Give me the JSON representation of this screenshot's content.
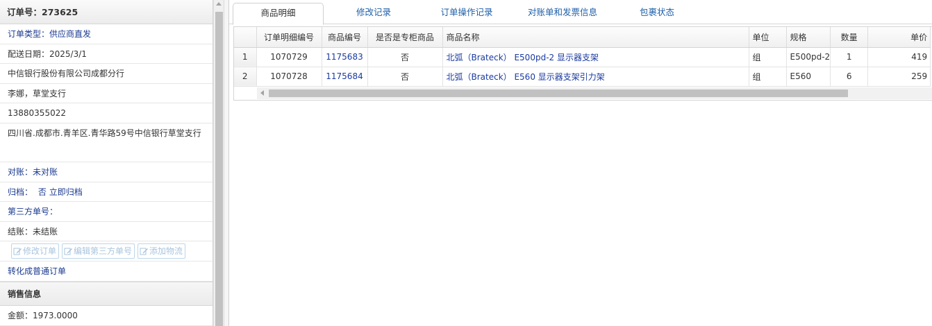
{
  "order": {
    "header": "订单号：273625",
    "type_label": "订单类型：",
    "type_value": "供应商直发",
    "delivery_date": "配送日期：2025/3/1",
    "company": "中信银行股份有限公司成都分行",
    "contact": "李娜，草堂支行",
    "phone": "13880355022",
    "address": "四川省.成都市.青羊区.青华路59号中信银行草堂支行",
    "reconcile": "对账：未对账",
    "archive_label": "归档：",
    "archive_value": "否",
    "archive_link": "立即归档",
    "third_party": "第三方单号：",
    "settlement": "结账：未结账",
    "buttons": {
      "edit_order": "修改订单",
      "edit_third_party": "编辑第三方单号",
      "add_logistics": "添加物流"
    },
    "convert_link": "转化成普通订单",
    "sales_section": "销售信息",
    "amount": "金额：1973.0000"
  },
  "tabs": [
    {
      "label": "商品明细",
      "active": true
    },
    {
      "label": "修改记录",
      "active": false
    },
    {
      "label": "订单操作记录",
      "active": false
    },
    {
      "label": "对账单和发票信息",
      "active": false
    },
    {
      "label": "包裹状态",
      "active": false
    }
  ],
  "table": {
    "columns": [
      "订单明细编号",
      "商品编号",
      "是否是专柜商品",
      "商品名称",
      "单位",
      "规格",
      "数量",
      "单价"
    ],
    "rows": [
      {
        "rownum": "1",
        "detail_id": "1070729",
        "product_id": "1175683",
        "counter": "否",
        "name": "北弧（Brateck） E500pd-2 显示器支架",
        "unit": "组",
        "spec": "E500pd-2",
        "qty": "1",
        "price": "419"
      },
      {
        "rownum": "2",
        "detail_id": "1070728",
        "product_id": "1175684",
        "counter": "否",
        "name": "北弧（Brateck） E560 显示器支架引力架",
        "unit": "组",
        "spec": "E560",
        "qty": "6",
        "price": "259"
      }
    ]
  },
  "colors": {
    "link": "#1a3aa0",
    "tab_text": "#1d5fa8",
    "disabled_button": "#a9c4dd"
  },
  "icons": {
    "edit": "edit-icon",
    "scroll_up": "arrow-up-icon",
    "scroll_left": "arrow-left-icon"
  }
}
